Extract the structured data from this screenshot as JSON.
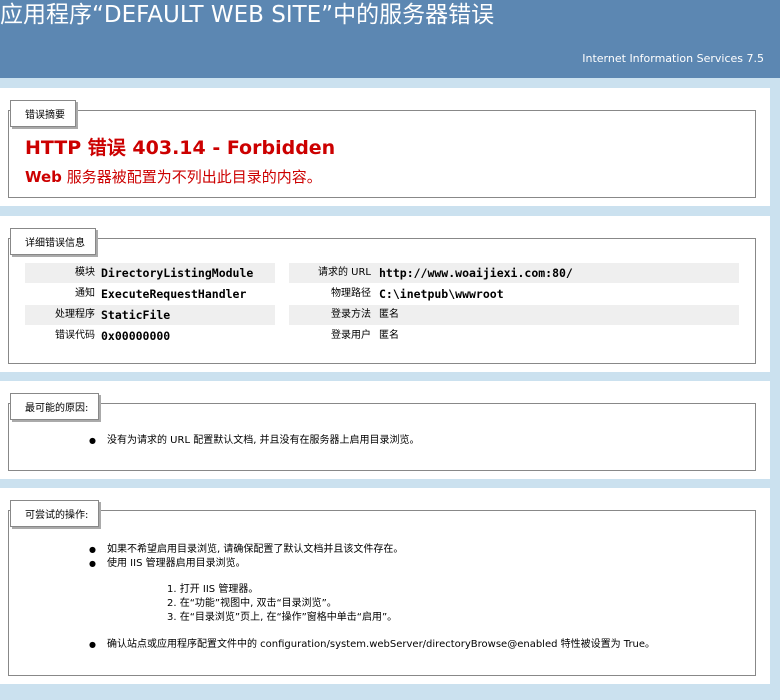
{
  "header": {
    "title": "应用程序“DEFAULT WEB SITE”中的服务器错误",
    "product": "Internet Information Services 7.5"
  },
  "summary": {
    "legend": "错误摘要",
    "title": "HTTP 错误 403.14 - Forbidden",
    "sub_bold": "Web",
    "sub_text": " 服务器被配置为不列出此目录的内容。"
  },
  "details": {
    "legend": "详细错误信息",
    "left": [
      {
        "label": "模块",
        "value": "DirectoryListingModule"
      },
      {
        "label": "通知",
        "value": "ExecuteRequestHandler"
      },
      {
        "label": "处理程序",
        "value": "StaticFile"
      },
      {
        "label": "错误代码",
        "value": "0x00000000"
      }
    ],
    "right": [
      {
        "label": "请求的 URL",
        "value": "http://www.woaijiexi.com:80/"
      },
      {
        "label": "物理路径",
        "value": "C:\\inetpub\\wwwroot"
      },
      {
        "label": "登录方法",
        "value": "匿名"
      },
      {
        "label": "登录用户",
        "value": "匿名"
      }
    ]
  },
  "causes": {
    "legend": "最可能的原因:",
    "items": [
      "没有为请求的 URL 配置默认文档, 并且没有在服务器上启用目录浏览。"
    ]
  },
  "actions": {
    "legend": "可尝试的操作:",
    "items_top": [
      "如果不希望启用目录浏览, 请确保配置了默认文档并且该文件存在。",
      "使用 IIS 管理器启用目录浏览。"
    ],
    "steps": [
      "1.  打开 IIS 管理器。",
      "2.  在“功能”视图中, 双击“目录浏览”。",
      "3.  在“目录浏览”页上, 在“操作”窗格中单击“启用”。"
    ],
    "items_bottom": [
      "确认站点或应用程序配置文件中的 configuration/system.webServer/directoryBrowse@enabled 特性被设置为 True。"
    ]
  }
}
